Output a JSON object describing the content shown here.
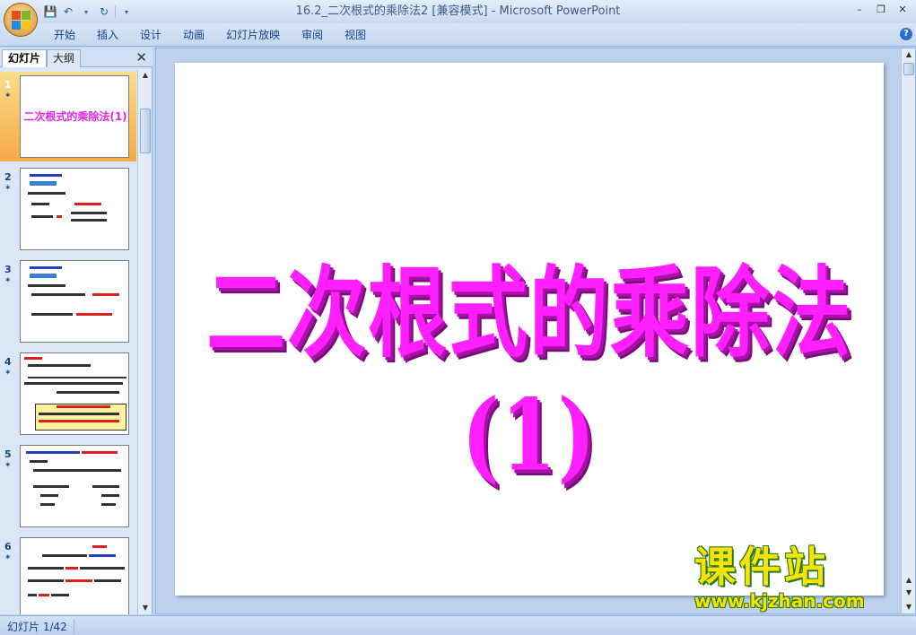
{
  "window": {
    "title": "16.2_二次根式的乘除法2 [兼容模式] - Microsoft PowerPoint"
  },
  "ribbon": {
    "tabs": [
      "开始",
      "插入",
      "设计",
      "动画",
      "幻灯片放映",
      "审阅",
      "视图"
    ]
  },
  "left_panel": {
    "tabs": [
      "幻灯片",
      "大纲"
    ],
    "active_tab": "幻灯片"
  },
  "slides": [
    {
      "number": "1",
      "thumb_title": "二次根式的乘除法(1)",
      "selected": true
    },
    {
      "number": "2",
      "selected": false
    },
    {
      "number": "3",
      "selected": false
    },
    {
      "number": "4",
      "selected": false
    },
    {
      "number": "5",
      "selected": false
    },
    {
      "number": "6",
      "selected": false
    }
  ],
  "current_slide": {
    "title": "二次根式的乘除法(1)"
  },
  "watermark": {
    "name": "课件站",
    "url": "www.kjzhan.com"
  },
  "status": {
    "slide_indicator": "幻灯片 1/42"
  },
  "colors": {
    "title_magenta": "#ff1fff",
    "selected_thumb": "#f5a947",
    "ribbon_blue": "#c5d7ef"
  }
}
